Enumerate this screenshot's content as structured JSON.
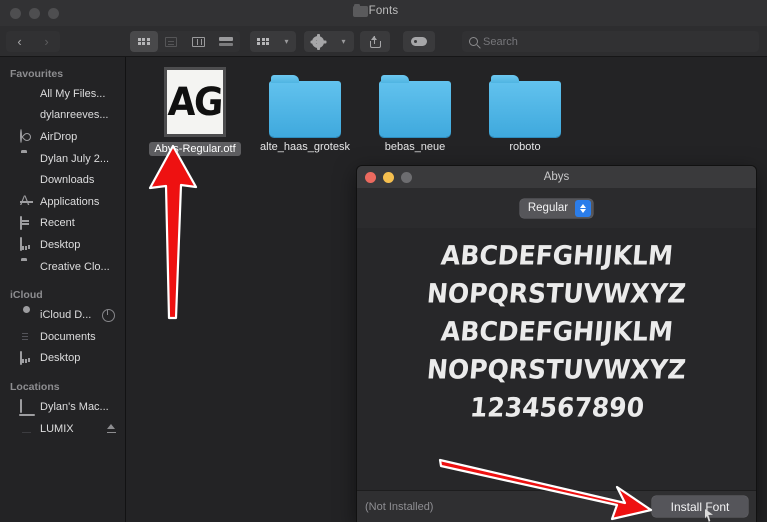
{
  "finder": {
    "window_title": "Fonts",
    "titlebar_icon": "folder-icon",
    "traffic_lights": [
      "close",
      "minimize",
      "zoom"
    ],
    "toolbar": {
      "back_label": "‹",
      "forward_label": "›",
      "view_modes": [
        "icon-view",
        "list-view",
        "column-view",
        "gallery-view"
      ],
      "selected_view": "icon-view",
      "group_button": "arrange-by",
      "action_button": "actions-gear",
      "share_button": "share",
      "tags_button": "tags"
    },
    "search": {
      "placeholder": "Search",
      "value": "",
      "icon": "search-icon"
    },
    "sidebar": {
      "sections": [
        {
          "title": "Favourites",
          "items": [
            {
              "label": "All My Files...",
              "icon": "document-icon"
            },
            {
              "label": "dylanreeves...",
              "icon": "home-icon"
            },
            {
              "label": "AirDrop",
              "icon": "airdrop-icon"
            },
            {
              "label": "Dylan July 2...",
              "icon": "folder-icon"
            },
            {
              "label": "Downloads",
              "icon": "downloads-icon"
            },
            {
              "label": "Applications",
              "icon": "applications-icon"
            },
            {
              "label": "Recent",
              "icon": "recent-icon"
            },
            {
              "label": "Desktop",
              "icon": "desktop-icon"
            },
            {
              "label": "Creative Clo...",
              "icon": "folder-icon"
            }
          ]
        },
        {
          "title": "iCloud",
          "items": [
            {
              "label": "iCloud D...",
              "icon": "cloud-icon",
              "accessory": "sync-progress-icon"
            },
            {
              "label": "Documents",
              "icon": "documents-icon"
            },
            {
              "label": "Desktop",
              "icon": "desktop-icon"
            }
          ]
        },
        {
          "title": "Locations",
          "items": [
            {
              "label": "Dylan's Mac...",
              "icon": "laptop-icon"
            },
            {
              "label": "LUMIX",
              "icon": "drive-icon",
              "accessory": "eject-icon"
            }
          ]
        }
      ]
    },
    "files": [
      {
        "label": "Abys-Regular.otf",
        "kind": "font-file",
        "thumb_text": "AG",
        "selected": true
      },
      {
        "label": "alte_haas_grotesk",
        "kind": "folder",
        "selected": false
      },
      {
        "label": "bebas_neue",
        "kind": "folder",
        "selected": false
      },
      {
        "label": "roboto",
        "kind": "folder",
        "selected": false
      }
    ]
  },
  "fontbook": {
    "window_title": "Abys",
    "traffic_lights": [
      "close",
      "minimize",
      "zoom"
    ],
    "style_popup": {
      "value": "Regular",
      "options": [
        "Regular"
      ]
    },
    "preview_lines": [
      "ABCDEFGHIJKLM",
      "NOPQRSTUVWXYZ",
      "ABCDEFGHIJKLM",
      "NOPQRSTUVWXYZ",
      "1234567890"
    ],
    "status_text": "(Not Installed)",
    "install_button_label": "Install Font",
    "cursor": "mouse-pointer"
  },
  "annotations": {
    "arrow_color": "#ee1111",
    "arrow_outline": "#ffffff",
    "arrows": [
      {
        "name": "arrow-to-font-file",
        "direction": "up"
      },
      {
        "name": "arrow-to-install-font",
        "direction": "down-right"
      }
    ]
  }
}
